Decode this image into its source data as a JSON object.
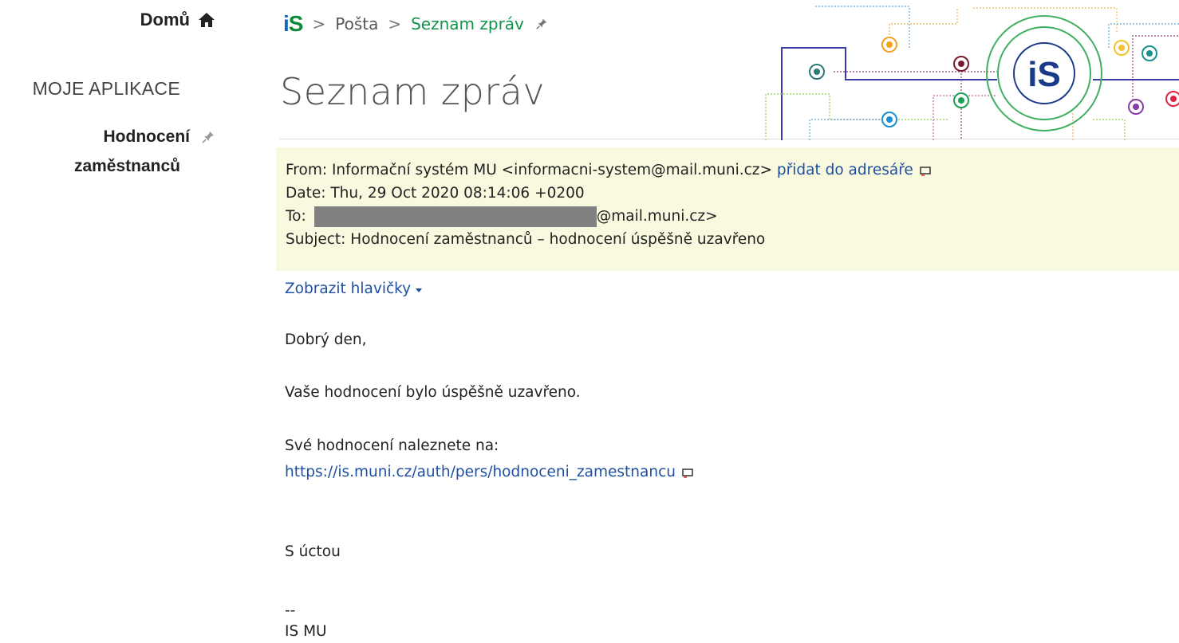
{
  "sidebar": {
    "home_label": "Domů",
    "section_title": "MOJE APLIKACE",
    "app_line1": "Hodnocení",
    "app_line2": "zaměstnanců"
  },
  "breadcrumb": {
    "logo": "iS",
    "sep": ">",
    "items": [
      "Pošta",
      "Seznam zpráv"
    ]
  },
  "page_title": "Seznam zpráv",
  "decor_logo": "iS",
  "mail": {
    "from_label": "From:",
    "from_value": "Informační systém MU <informacni-system@mail.muni.cz>",
    "add_to_contacts": "přidat do adresáře",
    "date_label": "Date:",
    "date_value": "Thu, 29 Oct 2020 08:14:06 +0200",
    "to_label": "To:",
    "to_value": "@mail.muni.cz>",
    "subject_label": "Subject:",
    "subject_value": "Hodnocení zaměstnanců – hodnocení úspěšně uzavřeno",
    "show_headers": "Zobrazit hlavičky",
    "body": {
      "greeting": "Dobrý den,",
      "line1": "Vaše hodnocení bylo úspěšně uzavřeno.",
      "line2": "Své hodnocení naleznete na:",
      "link": "https://is.muni.cz/auth/pers/hodnoceni_zamestnancu",
      "closing": "S úctou",
      "sig_sep": "--",
      "signature": "IS MU"
    }
  },
  "colors": {
    "accent_green": "#12924a",
    "link_blue": "#1f4fa0",
    "header_bg": "#f8f9df",
    "redaction": "#808080"
  },
  "icons": [
    "home-icon",
    "pin-icon",
    "external-link-icon",
    "caret-down-icon"
  ]
}
